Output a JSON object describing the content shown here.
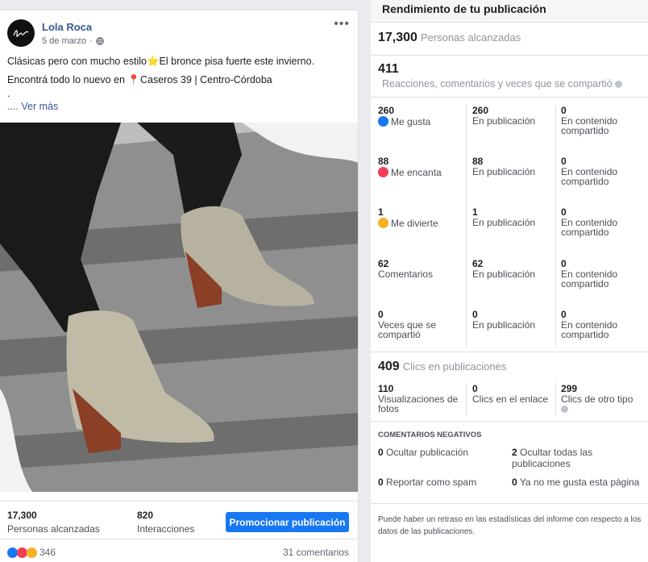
{
  "post": {
    "author": "Lola Roca",
    "date": "5 de marzo",
    "date_sep": "·",
    "more_label": "•••",
    "text_line1": "Clásicas pero con mucho estilo⭐El bronce pisa fuerte este invierno.",
    "text_line2": "Encontrá todo lo nuevo en 📍Caseros 39 | Centro-Córdoba",
    "text_line3": ".",
    "see_more": ".... Ver más",
    "reach_num": "17,300",
    "reach_label": "Personas alcanzadas",
    "inter_num": "820",
    "inter_label": "Interacciones",
    "promote_label": "Promocionar publicación",
    "reaction_count": "346",
    "comments_label": "31 comentarios"
  },
  "perf": {
    "title": "Rendimiento de tu publicación",
    "reach_num": "17,300",
    "reach_label": "Personas alcanzadas",
    "eng_num": "411",
    "eng_label": "Reacciones, comentarios y veces que se compartió",
    "rows": [
      {
        "total": "260",
        "label": "Me gusta",
        "on_post": "260",
        "on_post_label": "En publicación",
        "shared": "0",
        "shared_label": "En contenido compartido"
      },
      {
        "total": "88",
        "label": "Me encanta",
        "on_post": "88",
        "on_post_label": "En publicación",
        "shared": "0",
        "shared_label": "En contenido compartido"
      },
      {
        "total": "1",
        "label": "Me divierte",
        "on_post": "1",
        "on_post_label": "En publicación",
        "shared": "0",
        "shared_label": "En contenido compartido"
      },
      {
        "total": "62",
        "label": "Comentarios",
        "on_post": "62",
        "on_post_label": "En publicación",
        "shared": "0",
        "shared_label": "En contenido compartido"
      },
      {
        "total": "0",
        "label": "Veces que se compartió",
        "on_post": "0",
        "on_post_label": "En publicación",
        "shared": "0",
        "shared_label": "En contenido compartido"
      }
    ],
    "clicks_num": "409",
    "clicks_label": "Clics en publicaciones",
    "clicks": [
      {
        "num": "110",
        "label": "Visualizaciones de fotos"
      },
      {
        "num": "0",
        "label": "Clics en el enlace"
      },
      {
        "num": "299",
        "label": "Clics de otro tipo"
      }
    ],
    "neg_title": "COMENTARIOS NEGATIVOS",
    "neg": [
      {
        "num": "0",
        "label": "Ocultar publicación"
      },
      {
        "num": "2",
        "label": "Ocultar todas las publicaciones"
      },
      {
        "num": "0",
        "label": "Reportar como spam"
      },
      {
        "num": "0",
        "label": "Ya no me gusta esta página"
      }
    ],
    "footnote": "Puede haber un retraso en las estadísticas del informe con respecto a los datos de las publicaciones."
  },
  "colors": {
    "accent": "#1877f2",
    "link": "#385898",
    "love": "#f33e58",
    "haha": "#f7b125"
  }
}
